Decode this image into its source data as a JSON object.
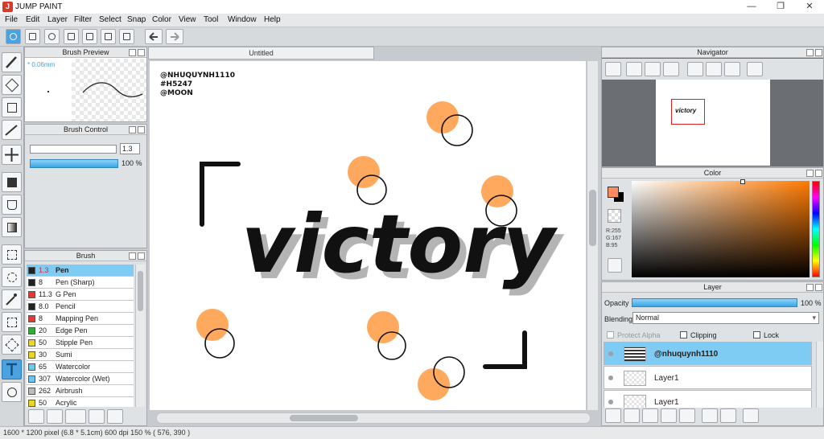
{
  "app": {
    "title": "JUMP PAINT",
    "window_buttons": [
      "—",
      "❐",
      "✕"
    ]
  },
  "menu": [
    "File",
    "Edit",
    "Layer",
    "Filter",
    "Select",
    "Snap",
    "Color",
    "View",
    "Tool",
    "Window",
    "Help"
  ],
  "panels": {
    "brush_preview": {
      "title": "Brush Preview",
      "size_label": "* 0.06mm"
    },
    "brush_control": {
      "title": "Brush Control",
      "size_value": "1.3",
      "opacity_value": "100 %"
    },
    "brush": {
      "title": "Brush",
      "items": [
        {
          "size": "1.3",
          "name": "Pen",
          "color": "#222222"
        },
        {
          "size": "8",
          "name": "Pen (Sharp)",
          "color": "#222222"
        },
        {
          "size": "11.3",
          "name": "G Pen",
          "color": "#e53935"
        },
        {
          "size": "8.0",
          "name": "Pencil",
          "color": "#222222"
        },
        {
          "size": "8",
          "name": "Mapping Pen",
          "color": "#e53935"
        },
        {
          "size": "20",
          "name": "Edge Pen",
          "color": "#35a83a"
        },
        {
          "size": "50",
          "name": "Stipple Pen",
          "color": "#ead629"
        },
        {
          "size": "30",
          "name": "Sumi",
          "color": "#ead629"
        },
        {
          "size": "65",
          "name": "Watercolor",
          "color": "#6ec7ef"
        },
        {
          "size": "307",
          "name": "Watercolor (Wet)",
          "color": "#6ec7ef"
        },
        {
          "size": "262",
          "name": "Airbrush",
          "color": "#bbbbbb"
        },
        {
          "size": "50",
          "name": "Acrylic",
          "color": "#ead629"
        }
      ]
    },
    "navigator": {
      "title": "Navigator"
    },
    "color": {
      "title": "Color",
      "r": "R:255",
      "g": "G:167",
      "b": "B:95",
      "main_color": "#ff8a5f"
    },
    "layer": {
      "title": "Layer",
      "opacity_label": "Opacity",
      "opacity_value": "100 %",
      "blending_label": "Blending",
      "blending_value": "Normal",
      "protect_alpha": "Protect Alpha",
      "clipping": "Clipping",
      "lock": "Lock",
      "layers": [
        "@nhuquynh1110",
        "Layer1",
        "Layer1"
      ]
    }
  },
  "document": {
    "tab_title": "Untitled",
    "canvas_text": {
      "tags": [
        "@NHUQUYNH1110",
        "#H5247",
        "@MOON"
      ],
      "word": "victory"
    }
  },
  "status": {
    "text": "1600 * 1200 pixel   (6.8 * 5.1cm)   600 dpi   150 %   ( 576, 390 )"
  },
  "colors": {
    "accent_blue": "#7ecbf3",
    "orange_dot": "#ffa95f",
    "selection_tool": "#4aa3e0"
  }
}
